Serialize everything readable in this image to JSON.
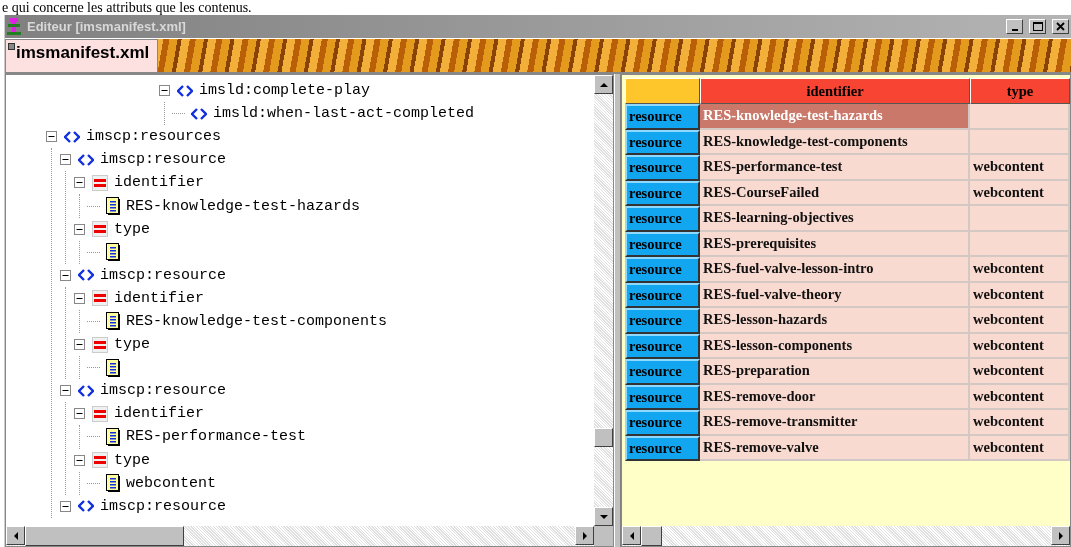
{
  "caption": "e qui concerne les attributs que les contenus.",
  "window": {
    "title": "Editeur [imsmanifest.xml]"
  },
  "tabs": [
    {
      "label": "imsmanifest.xml",
      "selected": true
    }
  ],
  "tree_top": [
    {
      "kind": "element",
      "label": "imsld:complete-play",
      "expanded": true,
      "children": [
        {
          "kind": "element",
          "label": "imsld:when-last-act-completed"
        }
      ]
    }
  ],
  "tree": [
    {
      "kind": "element",
      "label": "imscp:resources",
      "expanded": true,
      "children": [
        {
          "kind": "element",
          "label": "imscp:resource",
          "expanded": true,
          "children": [
            {
              "kind": "attribute",
              "label": "identifier",
              "expanded": true,
              "children": [
                {
                  "kind": "text",
                  "label": "RES-knowledge-test-hazards"
                }
              ]
            },
            {
              "kind": "attribute",
              "label": "type",
              "expanded": true,
              "children": [
                {
                  "kind": "text"
                }
              ]
            }
          ]
        },
        {
          "kind": "element",
          "label": "imscp:resource",
          "expanded": true,
          "children": [
            {
              "kind": "attribute",
              "label": "identifier",
              "expanded": true,
              "children": [
                {
                  "kind": "text",
                  "label": "RES-knowledge-test-components"
                }
              ]
            },
            {
              "kind": "attribute",
              "label": "type",
              "expanded": true,
              "children": [
                {
                  "kind": "text"
                }
              ]
            }
          ]
        },
        {
          "kind": "element",
          "label": "imscp:resource",
          "expanded": true,
          "children": [
            {
              "kind": "attribute",
              "label": "identifier",
              "expanded": true,
              "children": [
                {
                  "kind": "text",
                  "label": "RES-performance-test"
                }
              ]
            },
            {
              "kind": "attribute",
              "label": "type",
              "expanded": true,
              "children": [
                {
                  "kind": "text",
                  "label": "webcontent"
                }
              ]
            }
          ]
        },
        {
          "kind": "element",
          "label": "imscp:resource",
          "expanded": true
        }
      ]
    }
  ],
  "table": {
    "columns": [
      "identifier",
      "type"
    ],
    "rows": [
      {
        "label": "resource",
        "identifier": "RES-knowledge-test-hazards",
        "selected": true
      },
      {
        "label": "resource",
        "identifier": "RES-knowledge-test-components",
        "selected": false
      },
      {
        "label": "resource",
        "identifier": "RES-performance-test",
        "type": "webcontent",
        "selected": false
      },
      {
        "label": "resource",
        "identifier": "RES-CourseFailed",
        "type": "webcontent",
        "selected": false
      },
      {
        "label": "resource",
        "identifier": "RES-learning-objectives",
        "selected": false
      },
      {
        "label": "resource",
        "identifier": "RES-prerequisites",
        "selected": false
      },
      {
        "label": "resource",
        "identifier": "RES-fuel-valve-lesson-intro",
        "type": "webcontent",
        "selected": false
      },
      {
        "label": "resource",
        "identifier": "RES-fuel-valve-theory",
        "type": "webcontent",
        "selected": false
      },
      {
        "label": "resource",
        "identifier": "RES-lesson-hazards",
        "type": "webcontent",
        "selected": false
      },
      {
        "label": "resource",
        "identifier": "RES-lesson-components",
        "type": "webcontent",
        "selected": false
      },
      {
        "label": "resource",
        "identifier": "RES-preparation",
        "type": "webcontent",
        "selected": false
      },
      {
        "label": "resource",
        "identifier": "RES-remove-door",
        "type": "webcontent",
        "selected": false
      },
      {
        "label": "resource",
        "identifier": "RES-remove-transmitter",
        "type": "webcontent",
        "selected": false
      },
      {
        "label": "resource",
        "identifier": "RES-remove-valve",
        "type": "webcontent",
        "selected": false
      }
    ]
  }
}
